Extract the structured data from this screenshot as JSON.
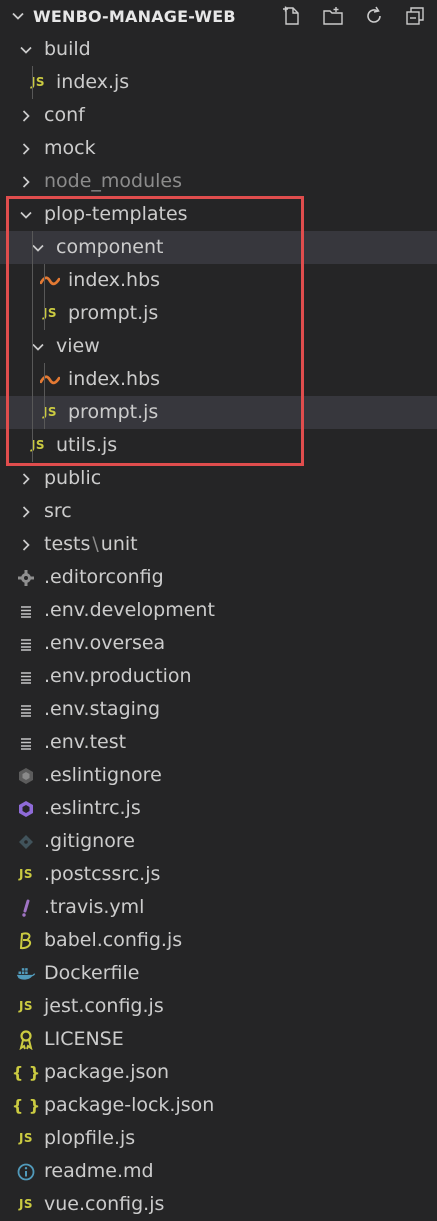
{
  "explorer": {
    "title": "WENBO-MANAGE-WEB",
    "actions": [
      {
        "name": "new-file-icon"
      },
      {
        "name": "new-folder-icon"
      },
      {
        "name": "refresh-icon"
      },
      {
        "name": "collapse-all-icon"
      }
    ]
  },
  "tree": {
    "items": [
      {
        "label": "build",
        "kind": "folder-open"
      },
      {
        "label": "index.js",
        "kind": "js"
      },
      {
        "label": "conf",
        "kind": "folder-closed"
      },
      {
        "label": "mock",
        "kind": "folder-closed"
      },
      {
        "label": "node_modules",
        "kind": "folder-closed"
      },
      {
        "label": "plop-templates",
        "kind": "folder-open"
      },
      {
        "label": "component",
        "kind": "folder-open"
      },
      {
        "label": "index.hbs",
        "kind": "hbs"
      },
      {
        "label": "prompt.js",
        "kind": "js"
      },
      {
        "label": "view",
        "kind": "folder-open"
      },
      {
        "label": "index.hbs",
        "kind": "hbs"
      },
      {
        "label": "prompt.js",
        "kind": "js"
      },
      {
        "label": "utils.js",
        "kind": "js"
      },
      {
        "label": "public",
        "kind": "folder-closed"
      },
      {
        "label": "src",
        "kind": "folder-closed"
      },
      {
        "label": "tests",
        "label2": "unit",
        "kind": "folder-closed"
      },
      {
        "label": ".editorconfig",
        "kind": "gear"
      },
      {
        "label": ".env.development",
        "kind": "lines"
      },
      {
        "label": ".env.oversea",
        "kind": "lines"
      },
      {
        "label": ".env.production",
        "kind": "lines"
      },
      {
        "label": ".env.staging",
        "kind": "lines"
      },
      {
        "label": ".env.test",
        "kind": "lines"
      },
      {
        "label": ".eslintignore",
        "kind": "eslint-ignore"
      },
      {
        "label": ".eslintrc.js",
        "kind": "eslint"
      },
      {
        "label": ".gitignore",
        "kind": "git"
      },
      {
        "label": ".postcssrc.js",
        "kind": "js"
      },
      {
        "label": ".travis.yml",
        "kind": "yml"
      },
      {
        "label": "babel.config.js",
        "kind": "babel"
      },
      {
        "label": "Dockerfile",
        "kind": "docker"
      },
      {
        "label": "jest.config.js",
        "kind": "js"
      },
      {
        "label": "LICENSE",
        "kind": "license"
      },
      {
        "label": "package.json",
        "kind": "json"
      },
      {
        "label": "package-lock.json",
        "kind": "json"
      },
      {
        "label": "plopfile.js",
        "kind": "js"
      },
      {
        "label": "readme.md",
        "kind": "info"
      },
      {
        "label": "vue.config.js",
        "kind": "js"
      }
    ],
    "js_badge": "JS",
    "json_badge": "{ }",
    "selected_label": "prompt.js",
    "colors": {
      "background": "#252526",
      "selection": "#37373d",
      "text": "#cccccc",
      "js": "#cbcb41",
      "hbs": "#e37933",
      "highlight_box": "#e04d4d"
    }
  }
}
